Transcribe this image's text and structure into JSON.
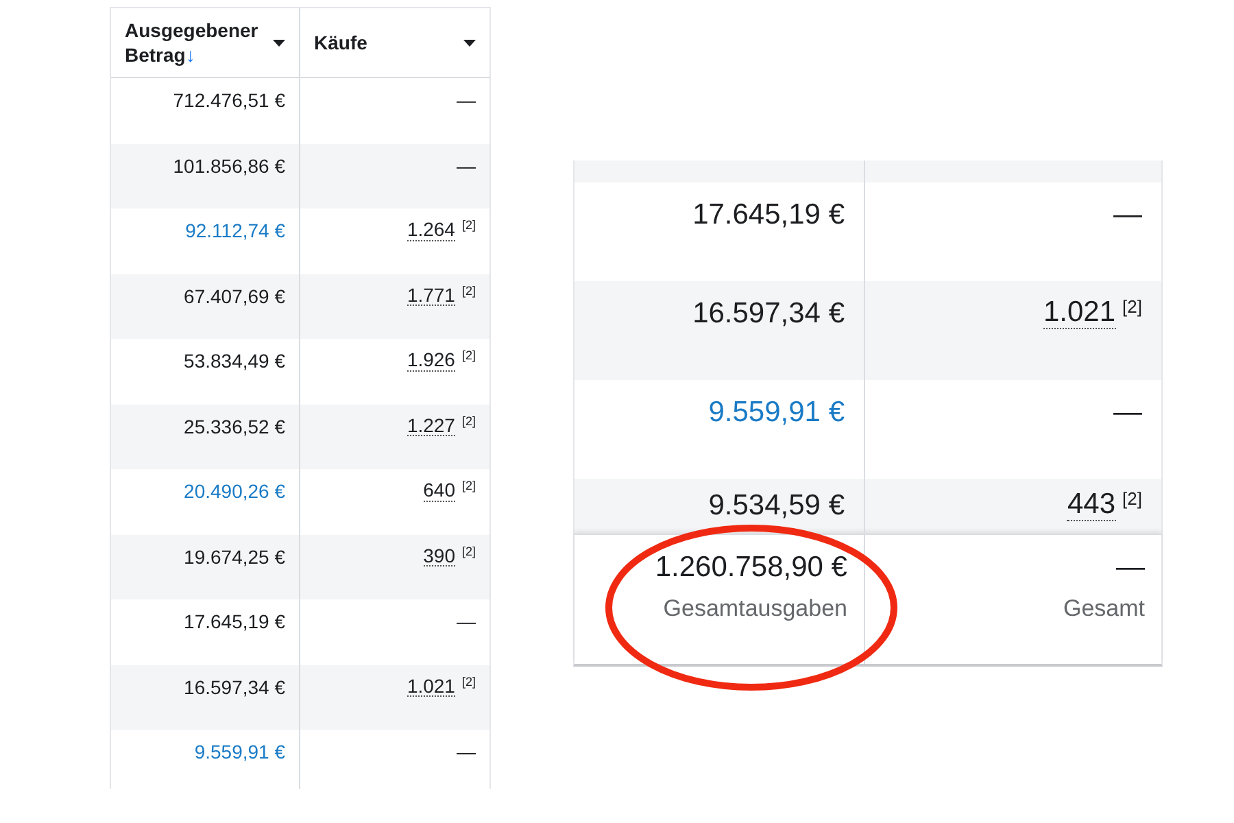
{
  "left_table": {
    "columns": [
      {
        "label": "Ausgegebener Betrag",
        "sort_icon": "↓"
      },
      {
        "label": "Käufe"
      }
    ],
    "rows": [
      {
        "amount": "712.476,51 €",
        "highlighted": false,
        "purchases": "—"
      },
      {
        "amount": "101.856,86 €",
        "highlighted": false,
        "purchases": "—"
      },
      {
        "amount": "92.112,74 €",
        "highlighted": true,
        "purchases": "1.264",
        "note": "[2]"
      },
      {
        "amount": "67.407,69 €",
        "highlighted": false,
        "purchases": "1.771",
        "note": "[2]"
      },
      {
        "amount": "53.834,49 €",
        "highlighted": false,
        "purchases": "1.926",
        "note": "[2]"
      },
      {
        "amount": "25.336,52 €",
        "highlighted": false,
        "purchases": "1.227",
        "note": "[2]"
      },
      {
        "amount": "20.490,26 €",
        "highlighted": true,
        "purchases": "640",
        "note": "[2]"
      },
      {
        "amount": "19.674,25 €",
        "highlighted": false,
        "purchases": "390",
        "note": "[2]"
      },
      {
        "amount": "17.645,19 €",
        "highlighted": false,
        "purchases": "—"
      },
      {
        "amount": "16.597,34 €",
        "highlighted": false,
        "purchases": "1.021",
        "note": "[2]"
      },
      {
        "amount": "9.559,91 €",
        "highlighted": true,
        "purchases": "—"
      }
    ]
  },
  "right_table": {
    "rows": [
      {
        "amount": "17.645,19 €",
        "highlighted": false,
        "purchases": "—"
      },
      {
        "amount": "16.597,34 €",
        "highlighted": false,
        "purchases": "1.021",
        "note": "[2]"
      },
      {
        "amount": "9.559,91 €",
        "highlighted": true,
        "purchases": "—"
      },
      {
        "amount": "9.534,59 €",
        "highlighted": false,
        "purchases": "443",
        "note": "[2]"
      }
    ],
    "totals": [
      {
        "value": "1.260.758,90 €",
        "label": "Gesamtausgaben"
      },
      {
        "value": "—",
        "label": "Gesamt"
      }
    ]
  }
}
